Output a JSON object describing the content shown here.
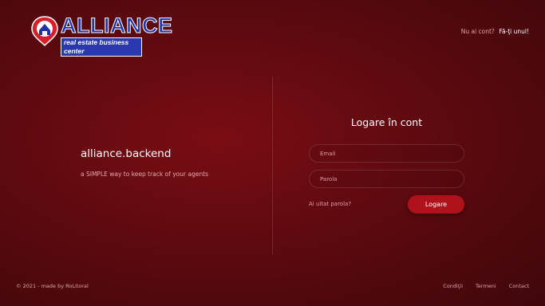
{
  "logo": {
    "main": "ALLIANCE",
    "sub": "real estate business center"
  },
  "header": {
    "prompt": "Nu ai cont?",
    "signup_link": "Fă-ţi unul!"
  },
  "brand": {
    "title": "alliance.backend",
    "tagline": "a SIMPLE way to keep track of your agents"
  },
  "login": {
    "title": "Logare în cont",
    "email_placeholder": "Email",
    "password_placeholder": "Parola",
    "forgot_link": "Ai uitat parola?",
    "submit_label": "Logare"
  },
  "footer": {
    "copyright": "© 2021 - made by RoLitoral",
    "links": [
      "Condiţii",
      "Termeni",
      "Contact"
    ]
  },
  "colors": {
    "accent": "#b0121c",
    "logo_blue": "#2233aa",
    "logo_red": "#d81e2a"
  }
}
